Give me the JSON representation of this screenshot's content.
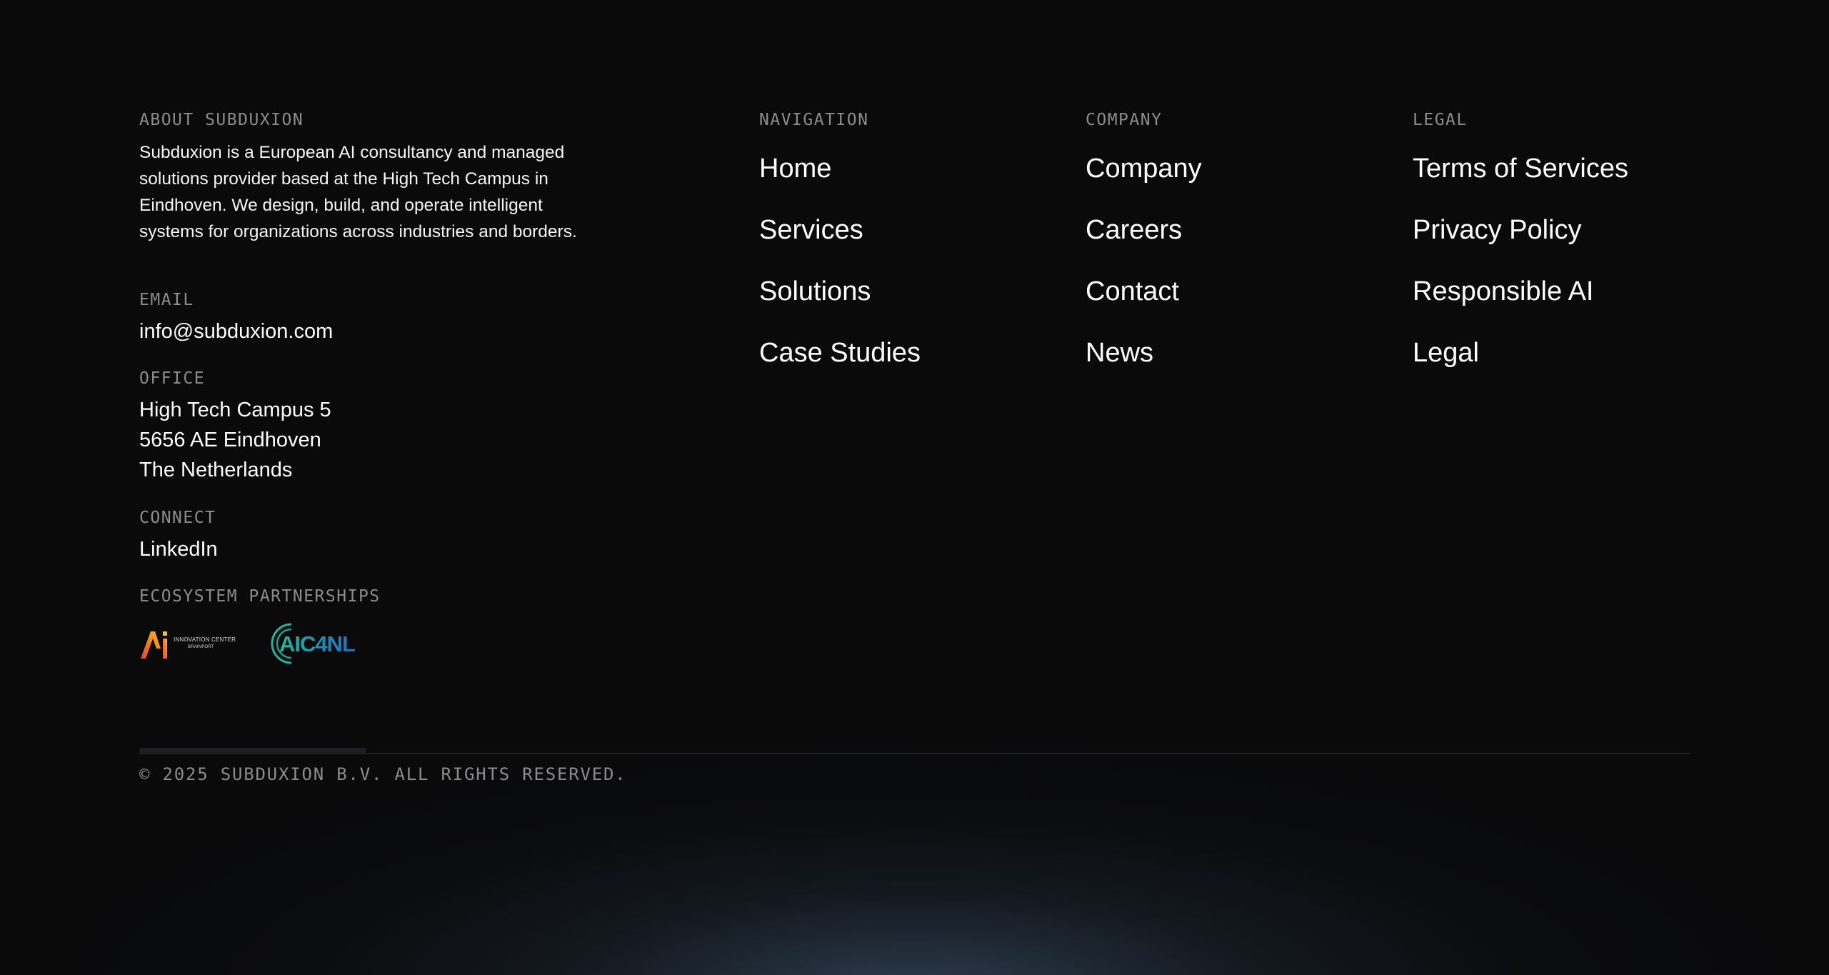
{
  "about": {
    "label": "ABOUT SUBDUXION",
    "description": "Subduxion is a European AI consultancy and managed solutions provider based at the High Tech Campus in Eindhoven. We design, build, and operate intelligent systems for organizations across industries and borders."
  },
  "email": {
    "label": "EMAIL",
    "value": "info@subduxion.com"
  },
  "office": {
    "label": "OFFICE",
    "lines": [
      "High Tech Campus 5",
      "5656 AE Eindhoven",
      "The Netherlands"
    ]
  },
  "connect": {
    "label": "CONNECT",
    "linkedin": "LinkedIn"
  },
  "ecosystem": {
    "label": "ECOSYSTEM PARTNERSHIPS",
    "partners": [
      {
        "name": "AI Innovation Center Brainport",
        "logo_text": "Ai",
        "caption_line1": "INNOVATION CENTER",
        "caption_line2": "BRAINPORT"
      },
      {
        "name": "AIC4NL",
        "logo_text": "AIC4NL"
      }
    ]
  },
  "navigation": {
    "label": "NAVIGATION",
    "links": [
      "Home",
      "Services",
      "Solutions",
      "Case Studies"
    ]
  },
  "company": {
    "label": "COMPANY",
    "links": [
      "Company",
      "Careers",
      "Contact",
      "News"
    ]
  },
  "legal": {
    "label": "LEGAL",
    "links": [
      "Terms of Services",
      "Privacy Policy",
      "Responsible AI",
      "Legal"
    ]
  },
  "copyright": "© 2025 SUBDUXION B.V. ALL RIGHTS RESERVED.",
  "colors": {
    "background": "#0a0a0b",
    "label": "#8c8c8c",
    "text": "#ffffff",
    "glow": "#486480"
  }
}
